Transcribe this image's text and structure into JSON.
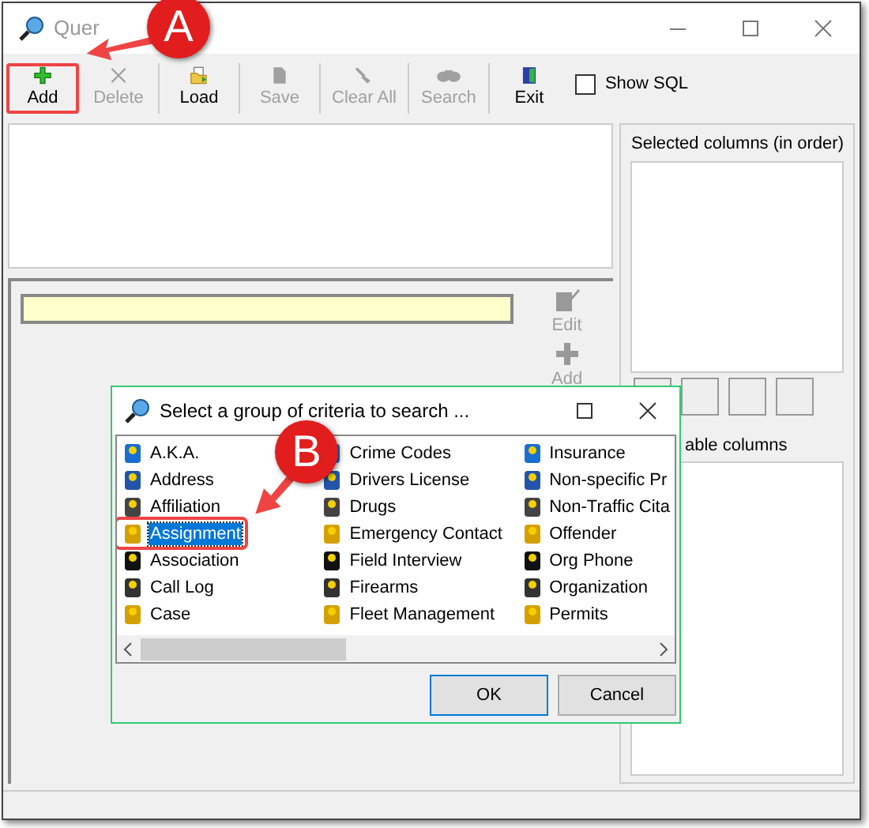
{
  "window": {
    "title": "Quer"
  },
  "toolbar": [
    {
      "label": "Add",
      "kind": "add",
      "disabled": false,
      "highlighted": true
    },
    {
      "label": "Delete",
      "kind": "delete",
      "disabled": true,
      "highlighted": false
    },
    {
      "label": "Load",
      "kind": "load",
      "disabled": false,
      "highlighted": false
    },
    {
      "label": "Save",
      "kind": "save",
      "disabled": true,
      "highlighted": false
    },
    {
      "label": "Clear All",
      "kind": "clear",
      "disabled": true,
      "highlighted": false
    },
    {
      "label": "Search",
      "kind": "search",
      "disabled": true,
      "highlighted": false
    },
    {
      "label": "Exit",
      "kind": "exit",
      "disabled": false,
      "highlighted": false
    }
  ],
  "show_sql": {
    "label": "Show SQL",
    "checked": false
  },
  "criteria_buttons": [
    {
      "label": "Edit",
      "disabled": true
    },
    {
      "label": "Add",
      "disabled": true
    }
  ],
  "right_panel": {
    "selected_label": "Selected columns (in order)",
    "available_label": "able columns"
  },
  "dialog": {
    "title": "Select a group of criteria to search ...",
    "items": [
      {
        "label": "A.K.A.",
        "selected": false,
        "highlighted": false
      },
      {
        "label": "Address",
        "selected": false,
        "highlighted": false
      },
      {
        "label": "Affiliation",
        "selected": false,
        "highlighted": false
      },
      {
        "label": "Assignment",
        "selected": true,
        "highlighted": true
      },
      {
        "label": "Association",
        "selected": false,
        "highlighted": false
      },
      {
        "label": "Call Log",
        "selected": false,
        "highlighted": false
      },
      {
        "label": "Case",
        "selected": false,
        "highlighted": false
      },
      {
        "label": "Crime Codes",
        "selected": false,
        "highlighted": false
      },
      {
        "label": "Drivers License",
        "selected": false,
        "highlighted": false
      },
      {
        "label": "Drugs",
        "selected": false,
        "highlighted": false
      },
      {
        "label": "Emergency Contact",
        "selected": false,
        "highlighted": false
      },
      {
        "label": "Field Interview",
        "selected": false,
        "highlighted": false
      },
      {
        "label": "Firearms",
        "selected": false,
        "highlighted": false
      },
      {
        "label": "Fleet Management",
        "selected": false,
        "highlighted": false
      },
      {
        "label": "Insurance",
        "selected": false,
        "highlighted": false
      },
      {
        "label": "Non-specific Pr",
        "selected": false,
        "highlighted": false
      },
      {
        "label": "Non-Traffic Cita",
        "selected": false,
        "highlighted": false
      },
      {
        "label": "Offender",
        "selected": false,
        "highlighted": false
      },
      {
        "label": "Org Phone",
        "selected": false,
        "highlighted": false
      },
      {
        "label": "Organization",
        "selected": false,
        "highlighted": false
      },
      {
        "label": "Permits",
        "selected": false,
        "highlighted": false
      }
    ],
    "buttons": [
      "OK",
      "Cancel"
    ]
  },
  "callouts": [
    {
      "letter": "A"
    },
    {
      "letter": "B"
    }
  ]
}
